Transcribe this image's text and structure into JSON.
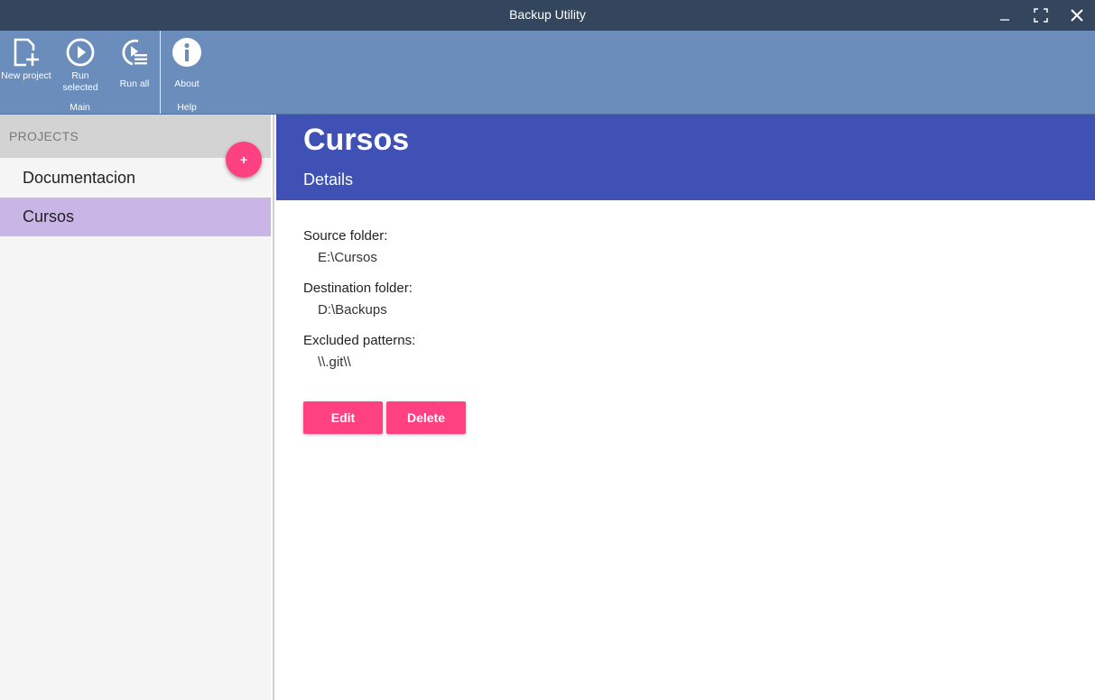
{
  "window": {
    "title": "Backup Utility",
    "controls": [
      "minimize",
      "maximize",
      "close"
    ]
  },
  "ribbon": {
    "groups": [
      {
        "name": "Main",
        "buttons": [
          {
            "label": "New project",
            "icon": "new-project-icon"
          },
          {
            "label": "Run selected",
            "icon": "play-circle-icon"
          },
          {
            "label": "Run all",
            "icon": "play-list-icon"
          }
        ]
      },
      {
        "name": "Help",
        "buttons": [
          {
            "label": "About",
            "icon": "info-icon"
          }
        ]
      }
    ]
  },
  "sidebar": {
    "header": "PROJECTS",
    "add_button": "+",
    "items": [
      {
        "label": "Documentacion",
        "selected": false
      },
      {
        "label": "Cursos",
        "selected": true
      }
    ]
  },
  "detail": {
    "name": "Cursos",
    "subtitle": "Details",
    "fields": [
      {
        "label": "Source folder:",
        "value": "E:\\Cursos"
      },
      {
        "label": "Destination folder:",
        "value": "D:\\Backups"
      },
      {
        "label": "Excluded patterns:",
        "value": "\\\\.git\\\\"
      }
    ],
    "buttons": {
      "edit": "Edit",
      "delete": "Delete"
    }
  },
  "colors": {
    "titlebar": "#34465e",
    "ribbon": "#6a8dbc",
    "header": "#3f51b5",
    "accent": "#ff4081",
    "selected_item": "#c9b6e6",
    "sidebar": "#f5f5f5"
  }
}
